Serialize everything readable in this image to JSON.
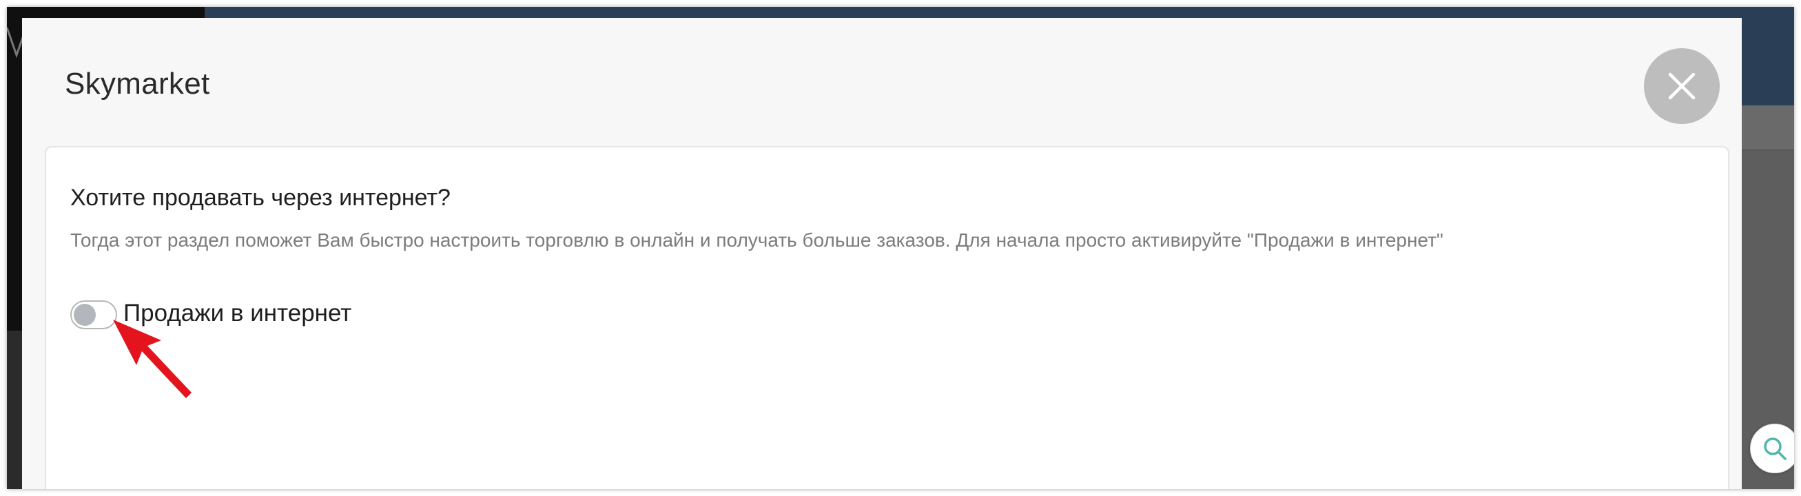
{
  "modal": {
    "title": "Skymarket",
    "close_icon": "close-icon"
  },
  "card": {
    "heading": "Хотите продавать через интернет?",
    "description": "Тогда этот раздел поможет Вам быстро настроить торговлю в онлайн и получать больше заказов. Для начала просто активируйте \"Продажи в интернет\"",
    "toggle": {
      "label": "Продажи в интернет",
      "checked": false
    }
  },
  "floating": {
    "search_icon": "search-icon"
  },
  "colors": {
    "accent_teal": "#4fb8a8",
    "arrow_red": "#e3141d",
    "header_navy": "#2a3e56"
  }
}
